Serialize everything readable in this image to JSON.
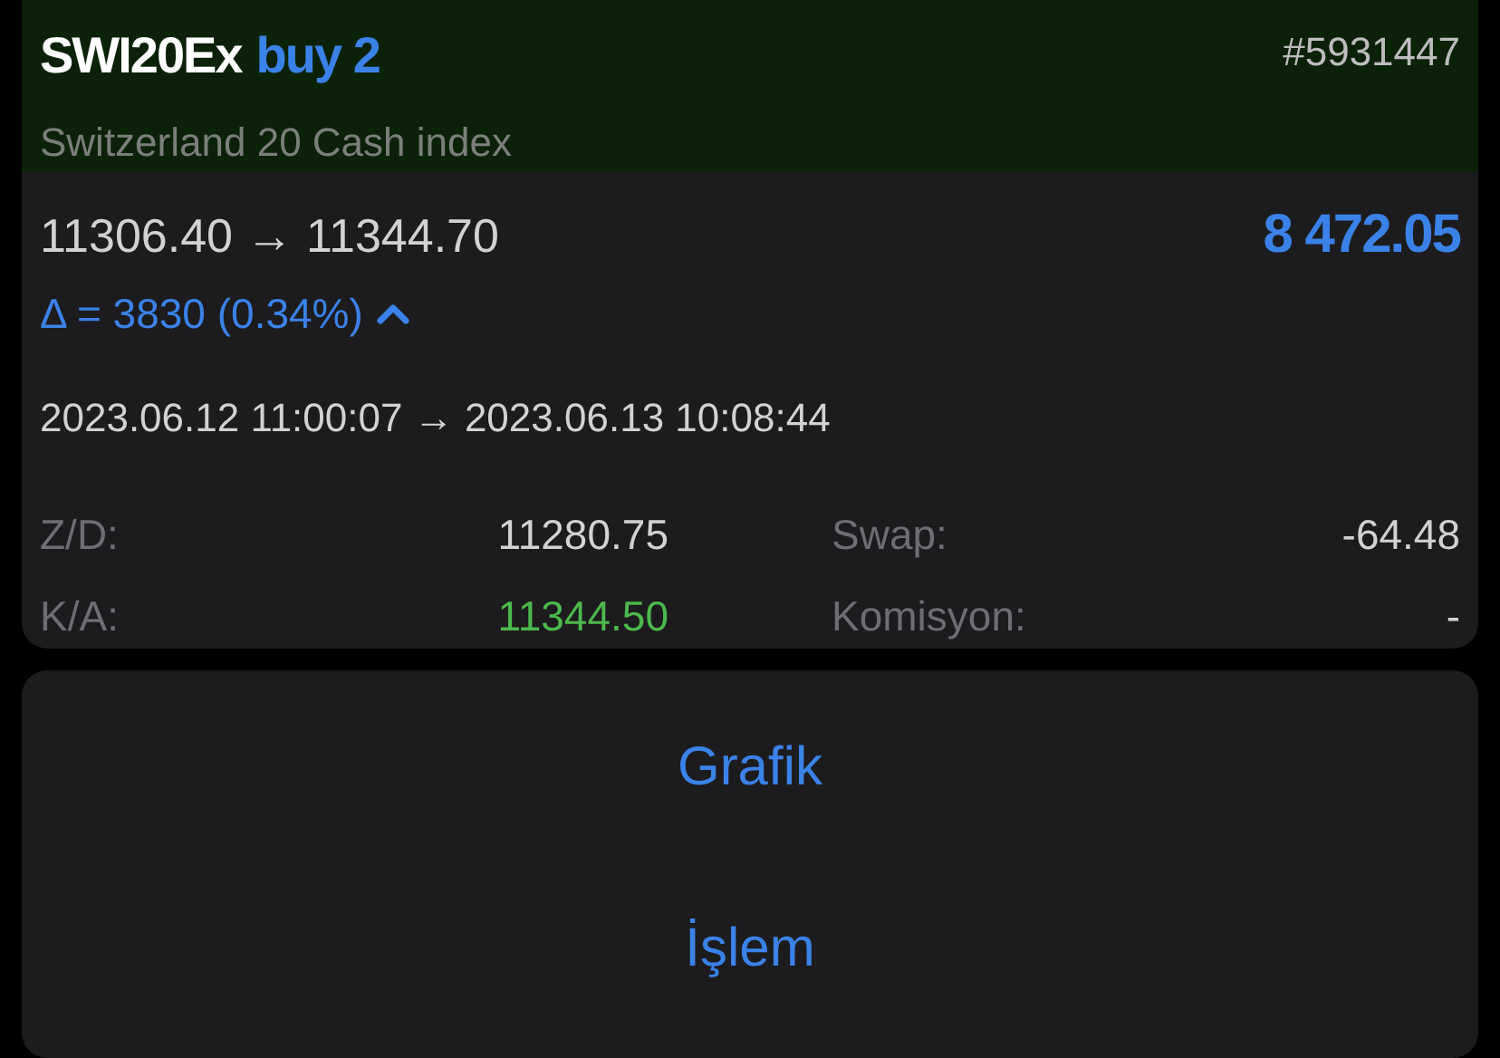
{
  "header": {
    "symbol": "SWI20Ex",
    "side": "buy 2",
    "ticket": "#5931447",
    "description": "Switzerland 20 Cash index"
  },
  "prices": {
    "open_close": "11306.40 → 11344.70",
    "profit": "8 472.05",
    "delta": "Δ = 3830 (0.34%)",
    "expanded": true
  },
  "times": "2023.06.12 11:00:07 → 2023.06.13 10:08:44",
  "stats": [
    {
      "label": "Z/D:",
      "value": "11280.75",
      "color": "#d2d2d4"
    },
    {
      "label": "Swap:",
      "value": "-64.48",
      "color": "#d2d2d4"
    },
    {
      "label": "K/A:",
      "value": "11344.50",
      "color": "#4cb84c"
    },
    {
      "label": "Komisyon:",
      "value": "-",
      "color": "#d2d2d4"
    }
  ],
  "actions": [
    "Grafik",
    "İşlem"
  ]
}
